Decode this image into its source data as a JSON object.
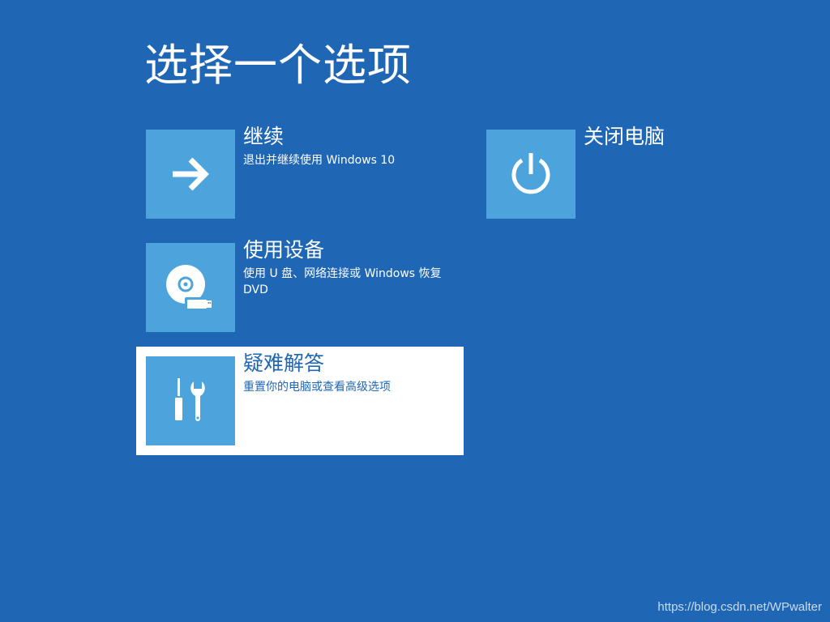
{
  "page": {
    "title": "选择一个选项",
    "background_color": "#1f66b5",
    "tile_color": "#4da3dc",
    "selected_color": "#ffffff"
  },
  "options": {
    "continue": {
      "title": "继续",
      "description": "退出并继续使用 Windows 10",
      "icon": "arrow-right-icon"
    },
    "use_device": {
      "title": "使用设备",
      "description": "使用 U 盘、网络连接或 Windows 恢复 DVD",
      "icon": "disc-usb-icon"
    },
    "troubleshoot": {
      "title": "疑难解答",
      "description": "重置你的电脑或查看高级选项",
      "icon": "tools-icon",
      "selected": true
    },
    "shutdown": {
      "title": "关闭电脑",
      "description": "",
      "icon": "power-icon"
    }
  },
  "watermark": "https://blog.csdn.net/WPwalter"
}
